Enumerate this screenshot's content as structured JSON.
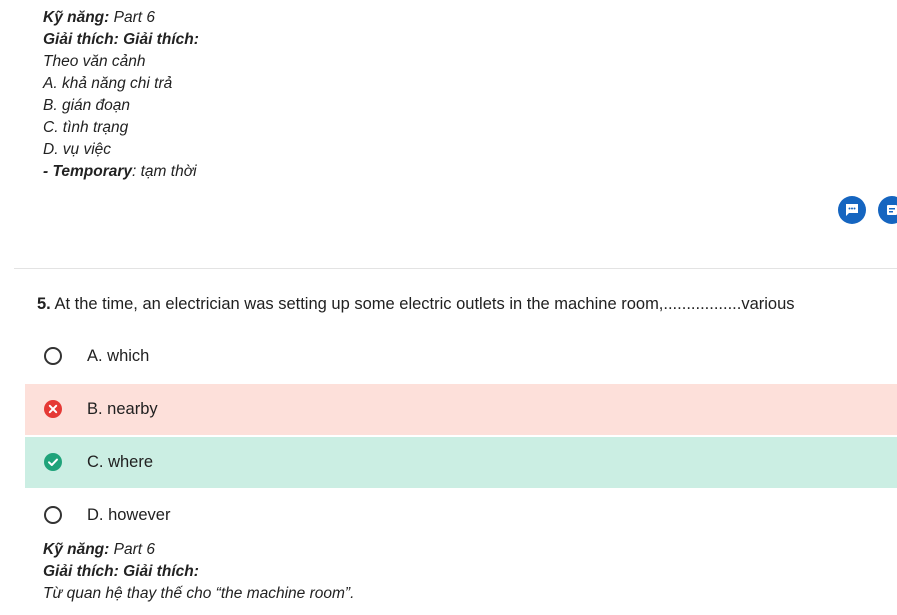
{
  "explanation_top": {
    "skill_label": "Kỹ năng:",
    "skill_value": " Part 6",
    "explain_label": "Giải thích: Giải thích:",
    "lines": [
      "Theo văn cảnh",
      "A. khả năng chi trả",
      "B. gián đoạn",
      "C. tình trạng",
      "D. vụ việc"
    ],
    "vocab_term": "- Temporary",
    "vocab_meaning": ": tạm thời"
  },
  "fab_buttons": {
    "comment_icon": "chat-bubble-icon",
    "second_icon": "note-icon",
    "color": "#1565c0"
  },
  "question": {
    "number": "5.",
    "text": " At the time, an electrician was setting up some electric outlets in the machine room,.................various"
  },
  "options": [
    {
      "label": "A. which",
      "state": "unselected"
    },
    {
      "label": "B. nearby",
      "state": "wrong"
    },
    {
      "label": "C. where",
      "state": "correct"
    },
    {
      "label": "D. however",
      "state": "unselected"
    }
  ],
  "colors": {
    "wrong_bg": "#fde0da",
    "correct_bg": "#cbeee3",
    "wrong_icon": "#e53935",
    "correct_icon": "#1fa37a"
  },
  "explanation_bottom": {
    "skill_label": "Kỹ năng:",
    "skill_value": " Part 6",
    "explain_label": "Giải thích: Giải thích:",
    "lines": [
      "Từ quan hệ thay thế cho “the machine room”."
    ]
  }
}
